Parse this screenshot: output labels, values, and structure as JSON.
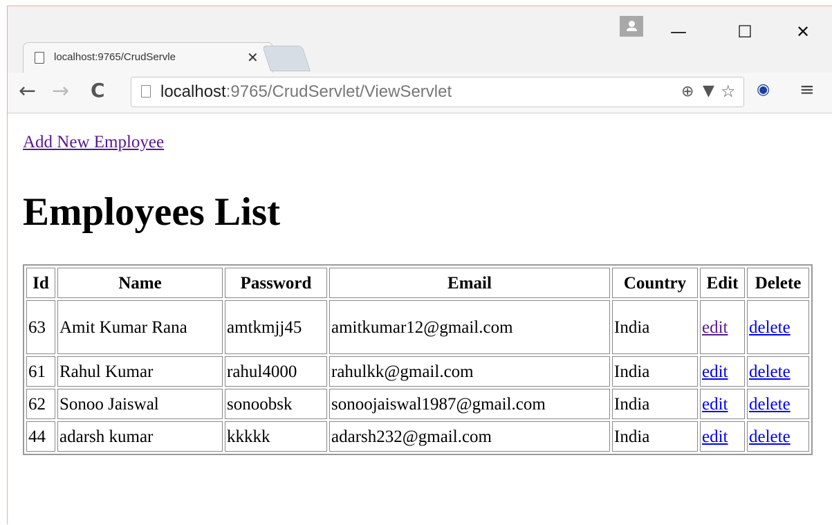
{
  "browser": {
    "tab_title": "localhost:9765/CrudServle",
    "tab_close_label": "✕",
    "url_host": "localhost",
    "url_path": ":9765/CrudServlet/ViewServlet",
    "window_buttons": {
      "minimize": "—",
      "maximize": "☐",
      "close": "✕"
    }
  },
  "page": {
    "add_link": "Add New Employee",
    "title": "Employees List"
  },
  "table": {
    "headers": [
      "Id",
      "Name",
      "Password",
      "Email",
      "Country",
      "Edit",
      "Delete"
    ],
    "rows": [
      {
        "id": "63",
        "name": "Amit Kumar Rana",
        "password": "amtkmjj45",
        "email": "amitkumar12@gmail.com",
        "country": "India",
        "edit": "edit",
        "delete": "delete"
      },
      {
        "id": "61",
        "name": "Rahul Kumar",
        "password": "rahul4000",
        "email": "rahulkk@gmail.com",
        "country": "India",
        "edit": "edit",
        "delete": "delete"
      },
      {
        "id": "62",
        "name": "Sonoo Jaiswal",
        "password": "sonoobsk",
        "email": "sonoojaiswal1987@gmail.com",
        "country": "India",
        "edit": "edit",
        "delete": "delete"
      },
      {
        "id": "44",
        "name": "adarsh kumar",
        "password": "kkkkk",
        "email": "adarsh232@gmail.com",
        "country": "India",
        "edit": "edit",
        "delete": "delete"
      }
    ]
  },
  "colors": {
    "link": "#0000ee",
    "visited_link": "#551a8b",
    "window_border": "#f0a99b"
  },
  "icons": [
    "page-icon",
    "back-arrow-icon",
    "forward-arrow-icon",
    "reload-icon",
    "zoom-icon",
    "key-icon",
    "star-icon",
    "extension-icon",
    "menu-icon",
    "profile-icon"
  ]
}
